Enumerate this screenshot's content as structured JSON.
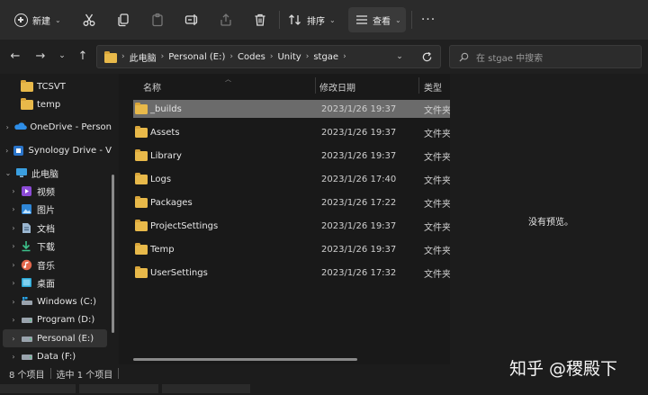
{
  "toolbar": {
    "new_label": "新建",
    "sort_label": "排序",
    "view_label": "查看",
    "more_label": "···"
  },
  "address": {
    "crumbs": [
      "此电脑",
      "Personal (E:)",
      "Codes",
      "Unity",
      "stgae"
    ]
  },
  "search": {
    "placeholder": "在 stgae 中搜索"
  },
  "sidebar": {
    "items": [
      {
        "label": "TCSVT",
        "icon": "folder-icon"
      },
      {
        "label": "temp",
        "icon": "folder-icon"
      },
      {
        "label": "OneDrive - Person",
        "icon": "onedrive-icon"
      },
      {
        "label": "Synology Drive - V",
        "icon": "synology-drive-icon"
      },
      {
        "label": "此电脑",
        "icon": "pc-icon"
      },
      {
        "label": "视频",
        "icon": "video-icon"
      },
      {
        "label": "图片",
        "icon": "pictures-icon"
      },
      {
        "label": "文档",
        "icon": "documents-icon"
      },
      {
        "label": "下载",
        "icon": "download-icon"
      },
      {
        "label": "音乐",
        "icon": "music-icon"
      },
      {
        "label": "桌面",
        "icon": "desktop-icon"
      },
      {
        "label": "Windows (C:)",
        "icon": "drive-icon"
      },
      {
        "label": "Program (D:)",
        "icon": "drive-icon"
      },
      {
        "label": "Personal (E:)",
        "icon": "drive-icon"
      },
      {
        "label": "Data (F:)",
        "icon": "drive-icon"
      }
    ]
  },
  "columns": {
    "name": "名称",
    "modified": "修改日期",
    "type": "类型"
  },
  "files": [
    {
      "name": "_builds",
      "modified": "2023/1/26 19:37",
      "type": "文件夹"
    },
    {
      "name": "Assets",
      "modified": "2023/1/26 19:37",
      "type": "文件夹"
    },
    {
      "name": "Library",
      "modified": "2023/1/26 19:37",
      "type": "文件夹"
    },
    {
      "name": "Logs",
      "modified": "2023/1/26 17:40",
      "type": "文件夹"
    },
    {
      "name": "Packages",
      "modified": "2023/1/26 17:22",
      "type": "文件夹"
    },
    {
      "name": "ProjectSettings",
      "modified": "2023/1/26 19:37",
      "type": "文件夹"
    },
    {
      "name": "Temp",
      "modified": "2023/1/26 19:37",
      "type": "文件夹"
    },
    {
      "name": "UserSettings",
      "modified": "2023/1/26 17:32",
      "type": "文件夹"
    }
  ],
  "preview": {
    "message": "没有预览。"
  },
  "status": {
    "item_count": "8 个项目",
    "selected": "选中 1 个项目"
  },
  "watermark": "知乎 @稷殿下",
  "colors": {
    "folder": "#e8b94a",
    "selected_row": "#6b6b6b",
    "background": "#191919"
  }
}
